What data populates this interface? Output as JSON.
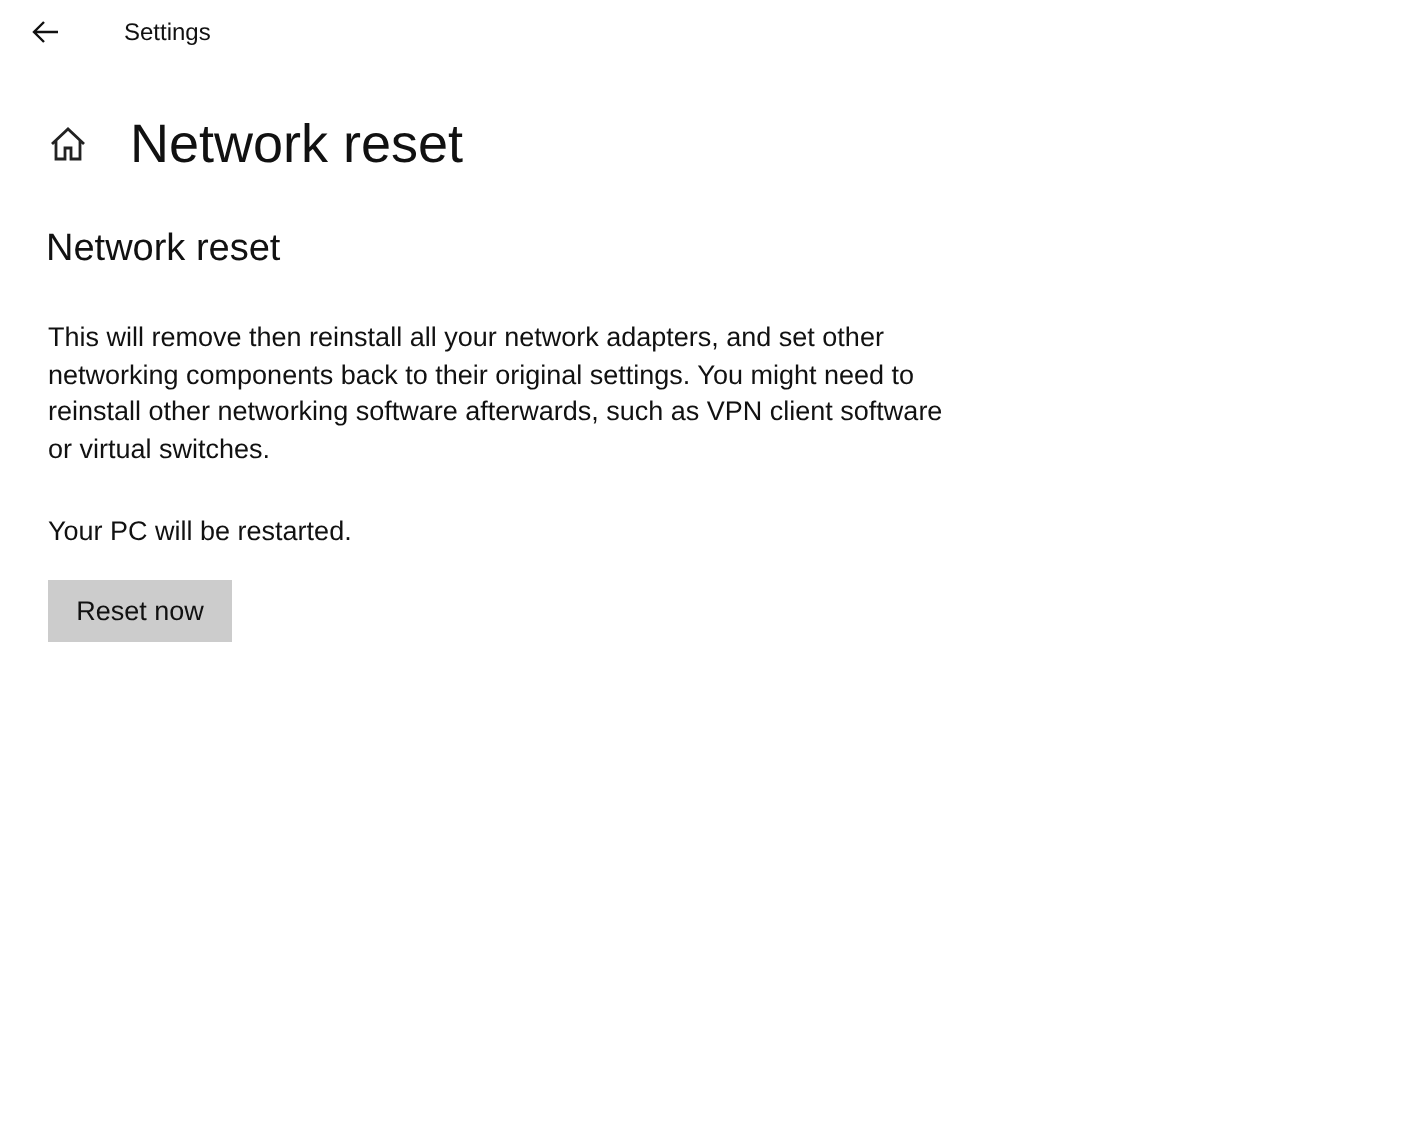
{
  "window": {
    "title": "Settings"
  },
  "page": {
    "title": "Network reset"
  },
  "section": {
    "heading": "Network reset",
    "description": "This will remove then reinstall all your network adapters, and set other networking components back to their original settings. You might need to reinstall other networking software afterwards, such as VPN client software or virtual switches.",
    "note": "Your PC will be restarted.",
    "button": "Reset now"
  }
}
